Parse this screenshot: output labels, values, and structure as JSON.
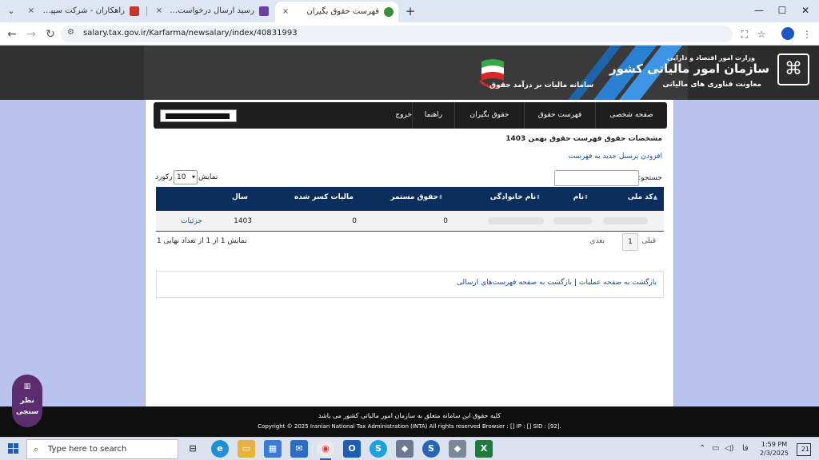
{
  "browser": {
    "tabs": [
      {
        "label": "راهکاران - شرکت سپیدار سیستم آ...",
        "close": "×",
        "favicon_color": "#c0392b",
        "active": false
      },
      {
        "label": "رسید ارسال درخواست به کارپوشه",
        "close": "×",
        "favicon_color": "#6a3fa0",
        "active": false
      },
      {
        "label": "فهرست حقوق بگیران",
        "close": "×",
        "favicon_color": "#3c8c3c",
        "active": true
      }
    ],
    "new_tab": "+",
    "window_controls": {
      "minimize": "—",
      "maximize": "☐",
      "close": "✕"
    },
    "url": "salary.tax.gov.ir/Karfarma/newsalary/index/40831993"
  },
  "header": {
    "org_sup": "وزارت امور اقتصاد و دارایی",
    "org_title": "سازمان امور مالیاتی کشور",
    "org_sub": "معاونت فناوری های مالیاتی",
    "system_title": "سامانه مالیات بر درآمد حقوق",
    "brand_color": "#2b7fd0"
  },
  "menu": {
    "items": [
      "صفحه شخصی",
      "فهرست حقوق",
      "حقوق بگیران",
      "راهنما",
      "خروج"
    ]
  },
  "page": {
    "section_title": "مشخصات حقوق فهرست حقوق بهمن 1403",
    "add_link": "افزودن پرسنل جدید به فهرست",
    "search_label": "جستجو:",
    "length_show": "نمایش",
    "length_value": "10",
    "length_records": "رکورد"
  },
  "table": {
    "columns": [
      "کد ملی",
      "نام",
      "نام خانوادگی",
      "حقوق مستمر",
      "مالیات کسر شده",
      "سال"
    ],
    "rows": [
      {
        "salary": "0",
        "tax": "0",
        "year": "1403",
        "action": "جزئیات"
      }
    ],
    "info": "نمایش 1 از 1 از تعداد نهایی 1",
    "pager": {
      "prev": "قبلی",
      "current": "1",
      "next": "بعدی"
    }
  },
  "back_links": {
    "operations": "بازگشت به صفحه عملیات",
    "separator": "|",
    "lists": "بازگشت به صفحه فهرست‌های ارسالی"
  },
  "footer": {
    "line1": "کلیه حقوق این سامانه متعلق به سازمان امور مالیاتی کشور می باشد",
    "line2": "Copyright © 2025 Iranian National Tax Administration (INTA) All rights reserved Browser : [] IP : [] SID : [92]."
  },
  "survey": {
    "icon": "▥",
    "label": "نظر سنجی"
  },
  "taskbar": {
    "search_placeholder": "Type here to search",
    "time": "1:59 PM",
    "date": "2/3/2025",
    "lang": "فا",
    "notifications": "21"
  }
}
